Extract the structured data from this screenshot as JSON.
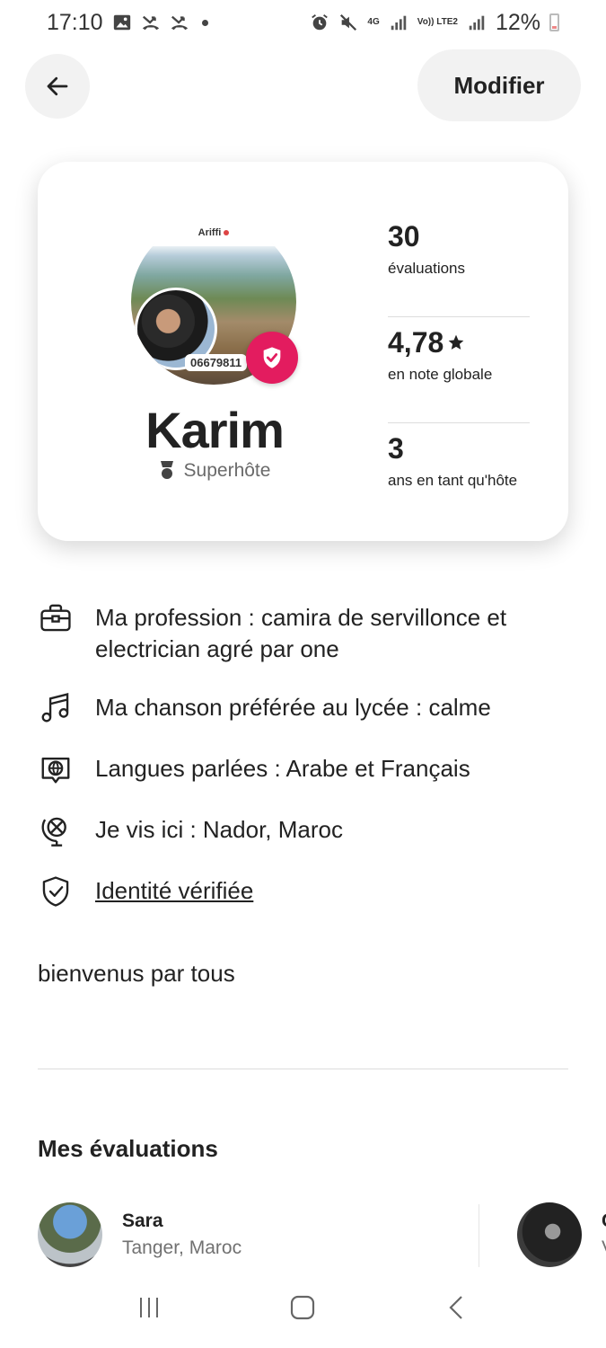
{
  "status_bar": {
    "time": "17:10",
    "battery": "12%",
    "network_4g": "4G",
    "volte": "Vo)) LTE2"
  },
  "header": {
    "edit_label": "Modifier"
  },
  "profile": {
    "avatar_overlay_name": "Ariffi",
    "avatar_overlay_phone": "06679811",
    "name": "Karim",
    "role": "Superhôte",
    "accent_color": "#e31c5f",
    "stats": [
      {
        "value": "30",
        "label": "évaluations"
      },
      {
        "value": "4,78",
        "label": "en note globale"
      },
      {
        "value": "3",
        "label": "ans en tant qu'hôte"
      }
    ]
  },
  "info": [
    {
      "icon": "briefcase-icon",
      "text": "Ma profession : camira de servillonce  et electrician agré par one"
    },
    {
      "icon": "music-note-icon",
      "text": "Ma chanson préférée au lycée : calme"
    },
    {
      "icon": "language-globe-icon",
      "text": "Langues parlées : Arabe et Français"
    },
    {
      "icon": "location-globe-icon",
      "text": "Je vis ici : Nador, Maroc"
    },
    {
      "icon": "shield-check-icon",
      "text": "Identité vérifiée"
    }
  ],
  "bio": "bienvenus par tous",
  "reviews": {
    "title": "Mes évaluations",
    "items": [
      {
        "name": "Sara",
        "location": "Tanger, Maroc"
      },
      {
        "name": "C",
        "location": "V"
      }
    ]
  }
}
